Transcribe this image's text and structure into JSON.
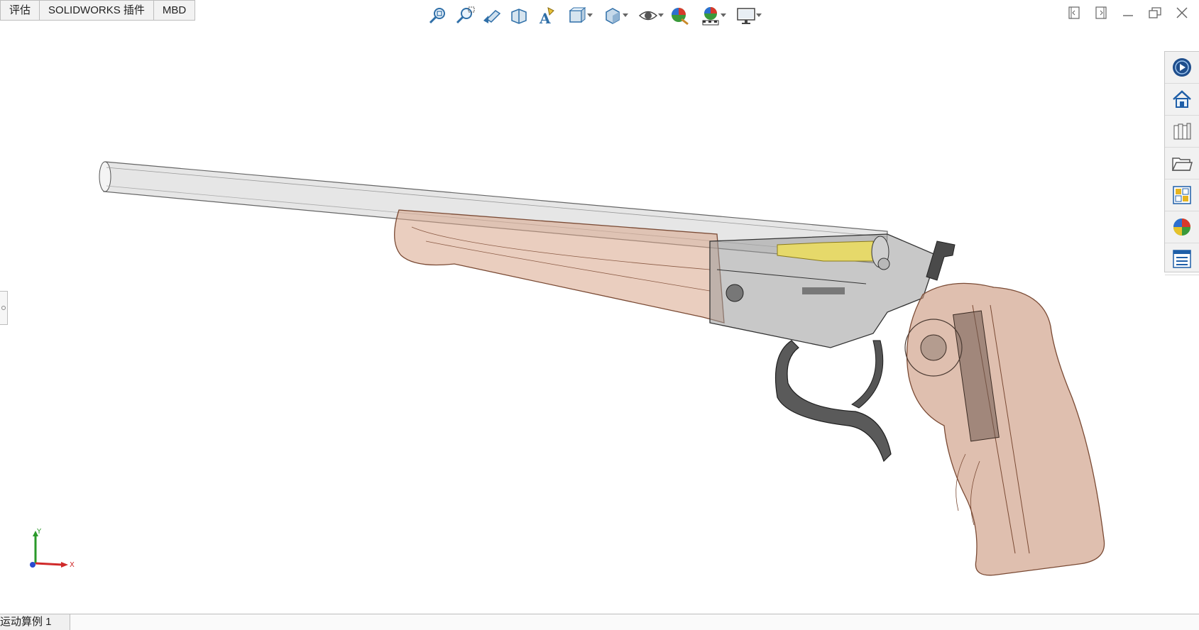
{
  "tabs": [
    {
      "label": "评估"
    },
    {
      "label": "SOLIDWORKS 插件"
    },
    {
      "label": "MBD"
    }
  ],
  "view_toolbar": [
    {
      "icon": "zoom-to-fit-icon"
    },
    {
      "icon": "zoom-to-area-icon"
    },
    {
      "icon": "previous-view-icon"
    },
    {
      "icon": "section-view-icon"
    },
    {
      "icon": "dynamic-annotation-views-icon"
    },
    {
      "icon": "view-orientation-icon",
      "dropdown": true
    },
    {
      "icon": "display-style-icon",
      "dropdown": true
    },
    {
      "icon": "hide-show-items-icon",
      "dropdown": true
    },
    {
      "icon": "edit-appearance-icon"
    },
    {
      "icon": "apply-scene-icon",
      "dropdown": true
    },
    {
      "icon": "view-settings-icon",
      "dropdown": true
    }
  ],
  "window_controls": [
    "tile-left-icon",
    "tile-right-icon",
    "minimize-icon",
    "restore-icon",
    "close-icon"
  ],
  "task_pane": [
    {
      "icon": "solidworks-resources-icon"
    },
    {
      "icon": "home-icon"
    },
    {
      "icon": "design-library-icon"
    },
    {
      "icon": "file-explorer-icon"
    },
    {
      "icon": "view-palette-icon"
    },
    {
      "icon": "appearances-scenes-icon"
    },
    {
      "icon": "custom-properties-icon"
    }
  ],
  "triad": {
    "x_label": "X",
    "y_label": "Y"
  },
  "bottom_tab": {
    "label": "运动算例 1"
  },
  "colors": {
    "grip": "#c9957a",
    "grip_stroke": "#7a4a34",
    "barrel": "#d9d9d9",
    "metal": "#5a5a5a",
    "cartridge": "#e6d96a"
  }
}
